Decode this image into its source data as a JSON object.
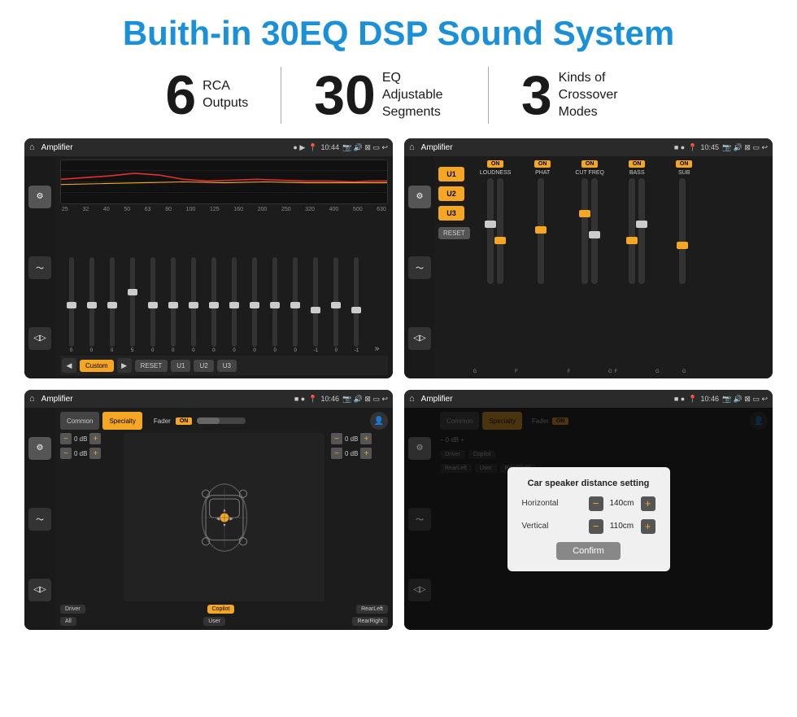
{
  "header": {
    "title": "Buith-in 30EQ DSP Sound System"
  },
  "stats": [
    {
      "number": "6",
      "label": "RCA\nOutputs"
    },
    {
      "number": "30",
      "label": "EQ Adjustable\nSegments"
    },
    {
      "number": "3",
      "label": "Kinds of\nCrossover Modes"
    }
  ],
  "screens": [
    {
      "id": "screen1",
      "statusbar": {
        "title": "Amplifier",
        "time": "10:44"
      },
      "type": "eq"
    },
    {
      "id": "screen2",
      "statusbar": {
        "title": "Amplifier",
        "time": "10:45"
      },
      "type": "amp"
    },
    {
      "id": "screen3",
      "statusbar": {
        "title": "Amplifier",
        "time": "10:46"
      },
      "type": "speaker"
    },
    {
      "id": "screen4",
      "statusbar": {
        "title": "Amplifier",
        "time": "10:46"
      },
      "type": "dialog"
    }
  ],
  "eq": {
    "frequencies": [
      "25",
      "32",
      "40",
      "50",
      "63",
      "80",
      "100",
      "125",
      "160",
      "200",
      "250",
      "320",
      "400",
      "500",
      "630"
    ],
    "values": [
      "0",
      "0",
      "0",
      "5",
      "0",
      "0",
      "0",
      "0",
      "0",
      "0",
      "0",
      "0",
      "-1",
      "0",
      "-1"
    ],
    "preset": "Custom",
    "buttons": [
      "RESET",
      "U1",
      "U2",
      "U3"
    ]
  },
  "amp": {
    "uButtons": [
      "U1",
      "U2",
      "U3"
    ],
    "columns": [
      {
        "label": "LOUDNESS",
        "on": true
      },
      {
        "label": "PHAT",
        "on": true
      },
      {
        "label": "CUT FREQ",
        "on": true
      },
      {
        "label": "BASS",
        "on": true
      },
      {
        "label": "SUB",
        "on": true
      }
    ]
  },
  "speaker": {
    "tabs": [
      "Common",
      "Specialty"
    ],
    "faderLabel": "Fader",
    "faderOn": "ON",
    "dbValues": [
      "0 dB",
      "0 dB",
      "0 dB",
      "0 dB"
    ],
    "bottomButtons": [
      "Driver",
      "Copilot",
      "RearLeft",
      "All",
      "User",
      "RearRight"
    ]
  },
  "dialog": {
    "title": "Car speaker distance setting",
    "horizontal": {
      "label": "Horizontal",
      "value": "140cm"
    },
    "vertical": {
      "label": "Vertical",
      "value": "110cm"
    },
    "confirmLabel": "Confirm"
  }
}
